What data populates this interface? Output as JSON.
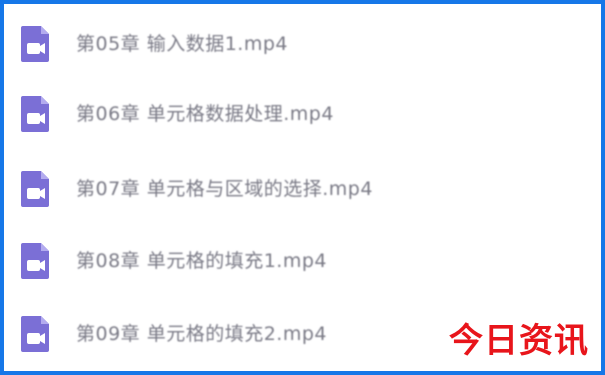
{
  "files": [
    {
      "name": "第05章 输入数据1.mp4",
      "icon": "video-file-icon"
    },
    {
      "name": "第06章 单元格数据处理.mp4",
      "icon": "video-file-icon"
    },
    {
      "name": "第07章 单元格与区域的选择.mp4",
      "icon": "video-file-icon"
    },
    {
      "name": "第08章 单元格的填充1.mp4",
      "icon": "video-file-icon"
    },
    {
      "name": "第09章 单元格的填充2.mp4",
      "icon": "video-file-icon"
    }
  ],
  "watermark": "今日资讯",
  "colors": {
    "border": "#1677e8",
    "icon_fill": "#7b6fd6",
    "icon_dark": "#5a4fc0",
    "watermark": "#e8151b",
    "file_text": "#7a7a86"
  }
}
